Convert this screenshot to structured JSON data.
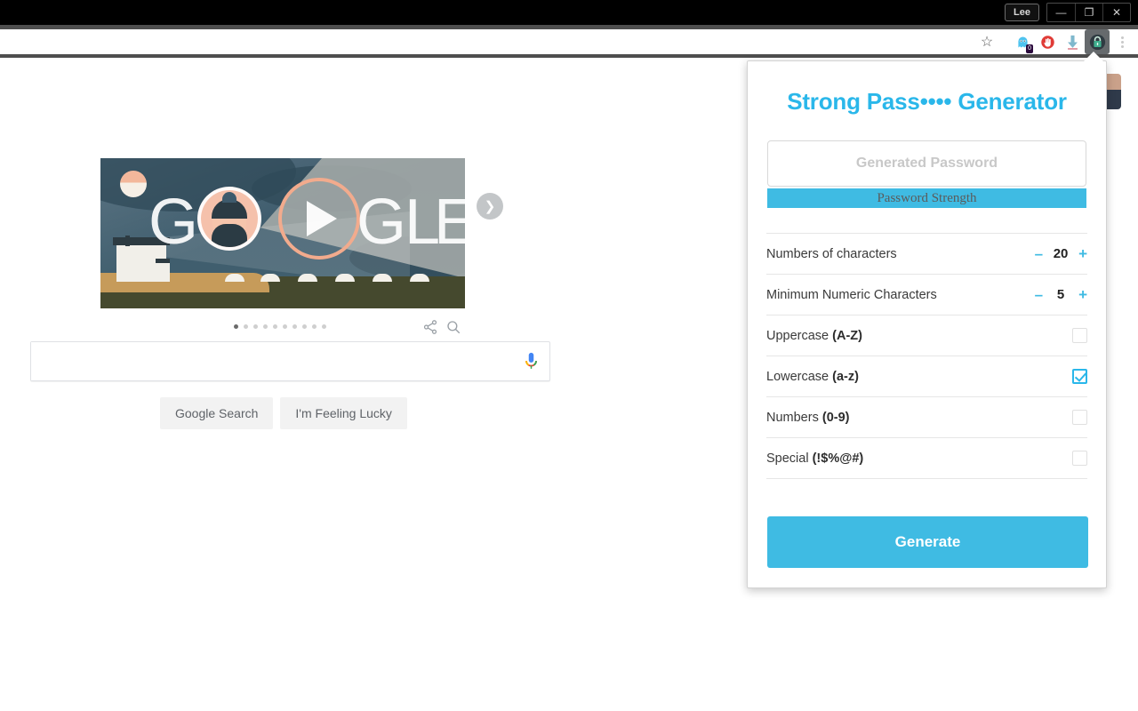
{
  "window": {
    "profile_label": "Lee",
    "minimize_label": "—",
    "maximize_label": "❐",
    "close_label": "✕"
  },
  "toolbar": {
    "bookmark_star": "☆",
    "extensions": [
      {
        "name": "ghostery-extension-icon",
        "badge": "0"
      },
      {
        "name": "adblock-extension-icon",
        "badge": ""
      },
      {
        "name": "download-icon",
        "badge": ""
      },
      {
        "name": "password-generator-extension-icon",
        "badge": ""
      }
    ],
    "menu_label": "⋮"
  },
  "page": {
    "doodle": {
      "letters": [
        "G",
        "O",
        "G",
        "L",
        "E"
      ],
      "next_arrow": "❯",
      "share_icon": "share-icon",
      "search_icon": "search-icon",
      "dot_count": 10,
      "active_dot": 1
    },
    "search": {
      "value": "",
      "placeholder": "",
      "mic_icon": "microphone-icon"
    },
    "buttons": {
      "search": "Google Search",
      "lucky": "I'm Feeling Lucky"
    }
  },
  "popup": {
    "title": "Strong Pass•••• Generator",
    "password_field": {
      "value": "",
      "placeholder": "Generated Password"
    },
    "strength_label": "Password Strength",
    "options": [
      {
        "label": "Numbers of characters",
        "type": "stepper",
        "minus": "–",
        "plus": "+",
        "value": "20"
      },
      {
        "label": "Minimum Numeric Characters",
        "type": "stepper",
        "minus": "–",
        "plus": "+",
        "value": "5"
      },
      {
        "label_main": "Uppercase ",
        "label_bold": "(A-Z)",
        "type": "checkbox",
        "checked": false
      },
      {
        "label_main": "Lowercase ",
        "label_bold": "(a-z)",
        "type": "checkbox",
        "checked": true
      },
      {
        "label_main": "Numbers ",
        "label_bold": "(0-9)",
        "type": "checkbox",
        "checked": false
      },
      {
        "label_main": "Special ",
        "label_bold": "(!$%@#)",
        "type": "checkbox",
        "checked": false
      }
    ],
    "generate_label": "Generate",
    "colors": {
      "accent": "#3fbbe3",
      "title": "#2ab7ea"
    }
  }
}
